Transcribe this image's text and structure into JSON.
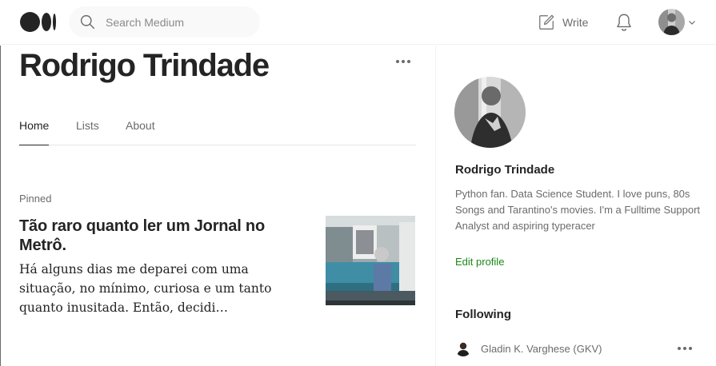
{
  "header": {
    "search": {
      "placeholder": "Search Medium"
    },
    "write_label": "Write"
  },
  "profile": {
    "name": "Rodrigo Trindade",
    "tabs": [
      {
        "label": "Home",
        "active": true
      },
      {
        "label": "Lists",
        "active": false
      },
      {
        "label": "About",
        "active": false
      }
    ]
  },
  "pinned_post": {
    "section_label": "Pinned",
    "title": "Tão raro quanto ler um Jornal no Metrô.",
    "excerpt": "Há alguns dias me deparei com uma situação, no mínimo, curiosa e um tanto quanto inusitada. Então, decidi compartilhar esse momento com vocês."
  },
  "sidebar": {
    "name": "Rodrigo Trindade",
    "bio": "Python fan. Data Science Student. I love puns, 80s Songs and Tarantino's movies. I'm a Fulltime Support Analyst and aspiring typeracer",
    "edit_profile_label": "Edit profile",
    "following_heading": "Following",
    "following": [
      {
        "name": "Gladin K. Varghese (GKV)"
      }
    ]
  },
  "colors": {
    "text_primary": "#242424",
    "text_secondary": "#6b6b6b",
    "accent_green": "#1a8917",
    "search_bg": "#f9f9f9"
  }
}
